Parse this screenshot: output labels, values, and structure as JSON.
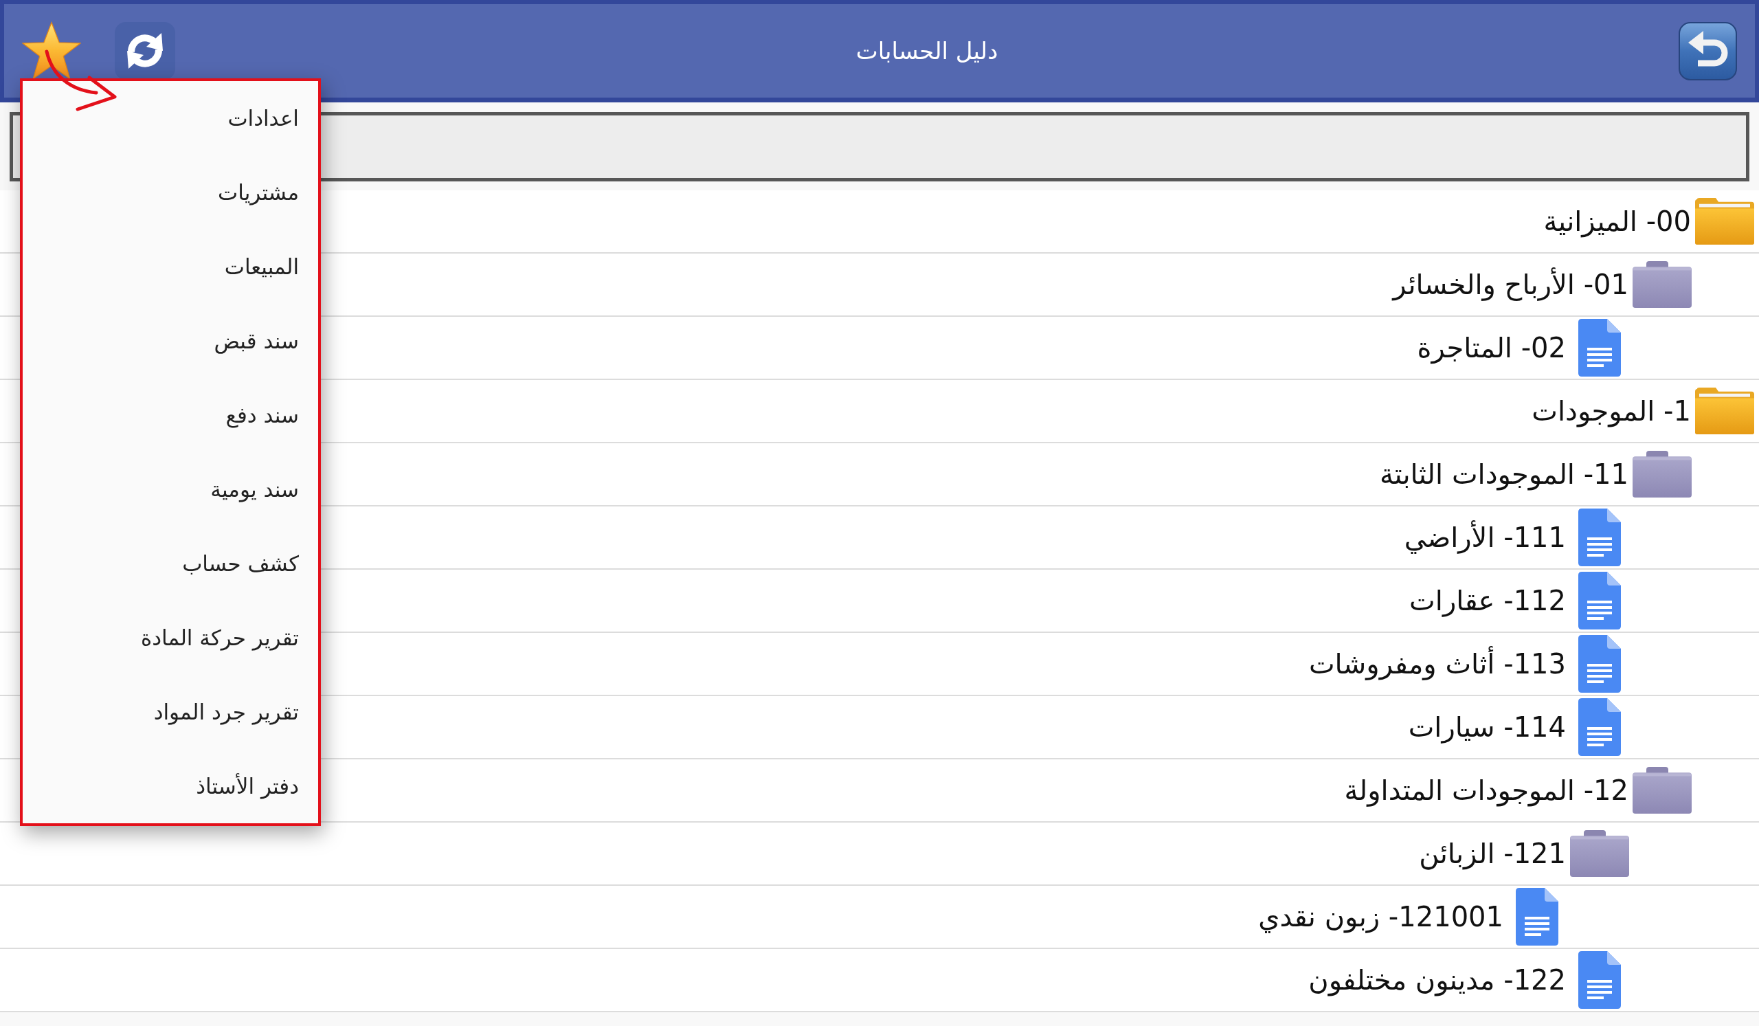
{
  "header": {
    "title": "دليل الحسابات"
  },
  "menu": {
    "items": [
      "اعدادات",
      "مشتريات",
      "المبيعات",
      "سند قبض",
      "سند دفع",
      "سند يومية",
      "كشف حساب",
      "تقرير حركة المادة",
      "تقرير جرد المواد",
      "دفتر الأستاذ"
    ]
  },
  "accounts": [
    {
      "label": "00- الميزانية",
      "kind": "folder",
      "children": [
        {
          "label": "01- الأرباح والخسائر",
          "kind": "folder",
          "children": [
            {
              "label": "02- المتاجرة",
              "kind": "document"
            }
          ]
        }
      ]
    },
    {
      "label": "1- الموجودات",
      "kind": "folder",
      "children": [
        {
          "label": "11- الموجودات الثابتة",
          "kind": "folder",
          "children": [
            {
              "label": "111- الأراضي",
              "kind": "document"
            },
            {
              "label": "112- عقارات",
              "kind": "document"
            },
            {
              "label": "113- أثاث ومفروشات",
              "kind": "document"
            },
            {
              "label": "114- سيارات",
              "kind": "document"
            }
          ]
        },
        {
          "label": "12- الموجودات المتداولة",
          "kind": "folder",
          "children": [
            {
              "label": "121- الزبائن",
              "kind": "folder",
              "children": [
                {
                  "label": "121001- زبون نقدي",
                  "kind": "document"
                }
              ]
            },
            {
              "label": "122- مدينون مختلفون",
              "kind": "document"
            }
          ]
        }
      ]
    }
  ]
}
